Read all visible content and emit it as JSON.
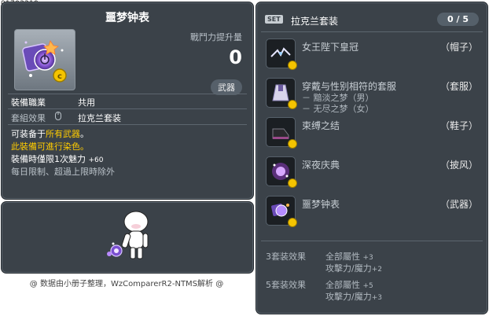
{
  "item_id": "01703219",
  "item": {
    "title": "噩梦钟表",
    "combat_power_label": "戰鬥力提升量",
    "combat_power_value": "0",
    "category_tag": "武器",
    "job_label": "裝備職業",
    "job_value": "共用",
    "set_label": "套組效果",
    "set_value": "拉克兰套装",
    "desc_line1_prefix": "可装备于",
    "desc_line1_highlight": "所有武器",
    "desc_line1_suffix": "。",
    "desc_line2": "此裝備可進行染色。",
    "desc_line3_label": "裝備時僅限1次魅力",
    "desc_line3_value": "+60",
    "desc_line4": "每日限制、超過上限時除外"
  },
  "watermark": "@ 数据由小册子整理，WzComparerR2-NTMS解析 @",
  "set_panel": {
    "badge": "SET",
    "title": "拉克兰套装",
    "count": "0 / 5",
    "items": [
      {
        "name": "女王陛下皇冠",
        "type": "（帽子）",
        "sub": []
      },
      {
        "name": "穿戴与性别相符的套服",
        "type": "（套服）",
        "sub": [
          "－ 黯淡之梦（男）",
          "－ 无尽之梦（女）"
        ]
      },
      {
        "name": "束缚之结",
        "type": "（鞋子）",
        "sub": []
      },
      {
        "name": "深夜庆典",
        "type": "（披风）",
        "sub": []
      },
      {
        "name": "噩梦钟表",
        "type": "（武器）",
        "sub": []
      }
    ],
    "effects": [
      {
        "label": "3套装效果",
        "lines": [
          [
            "全部屬性",
            "+3"
          ],
          [
            "攻擊力/魔力",
            "+2"
          ]
        ]
      },
      {
        "label": "5套装效果",
        "lines": [
          [
            "全部屬性",
            "+5"
          ],
          [
            "攻擊力/魔力",
            "+3"
          ]
        ]
      }
    ]
  },
  "colors": {
    "panel_bg": "#3b4249",
    "highlight": "#ffcc00",
    "text": "#ffffff",
    "muted": "#b9c1c8"
  }
}
